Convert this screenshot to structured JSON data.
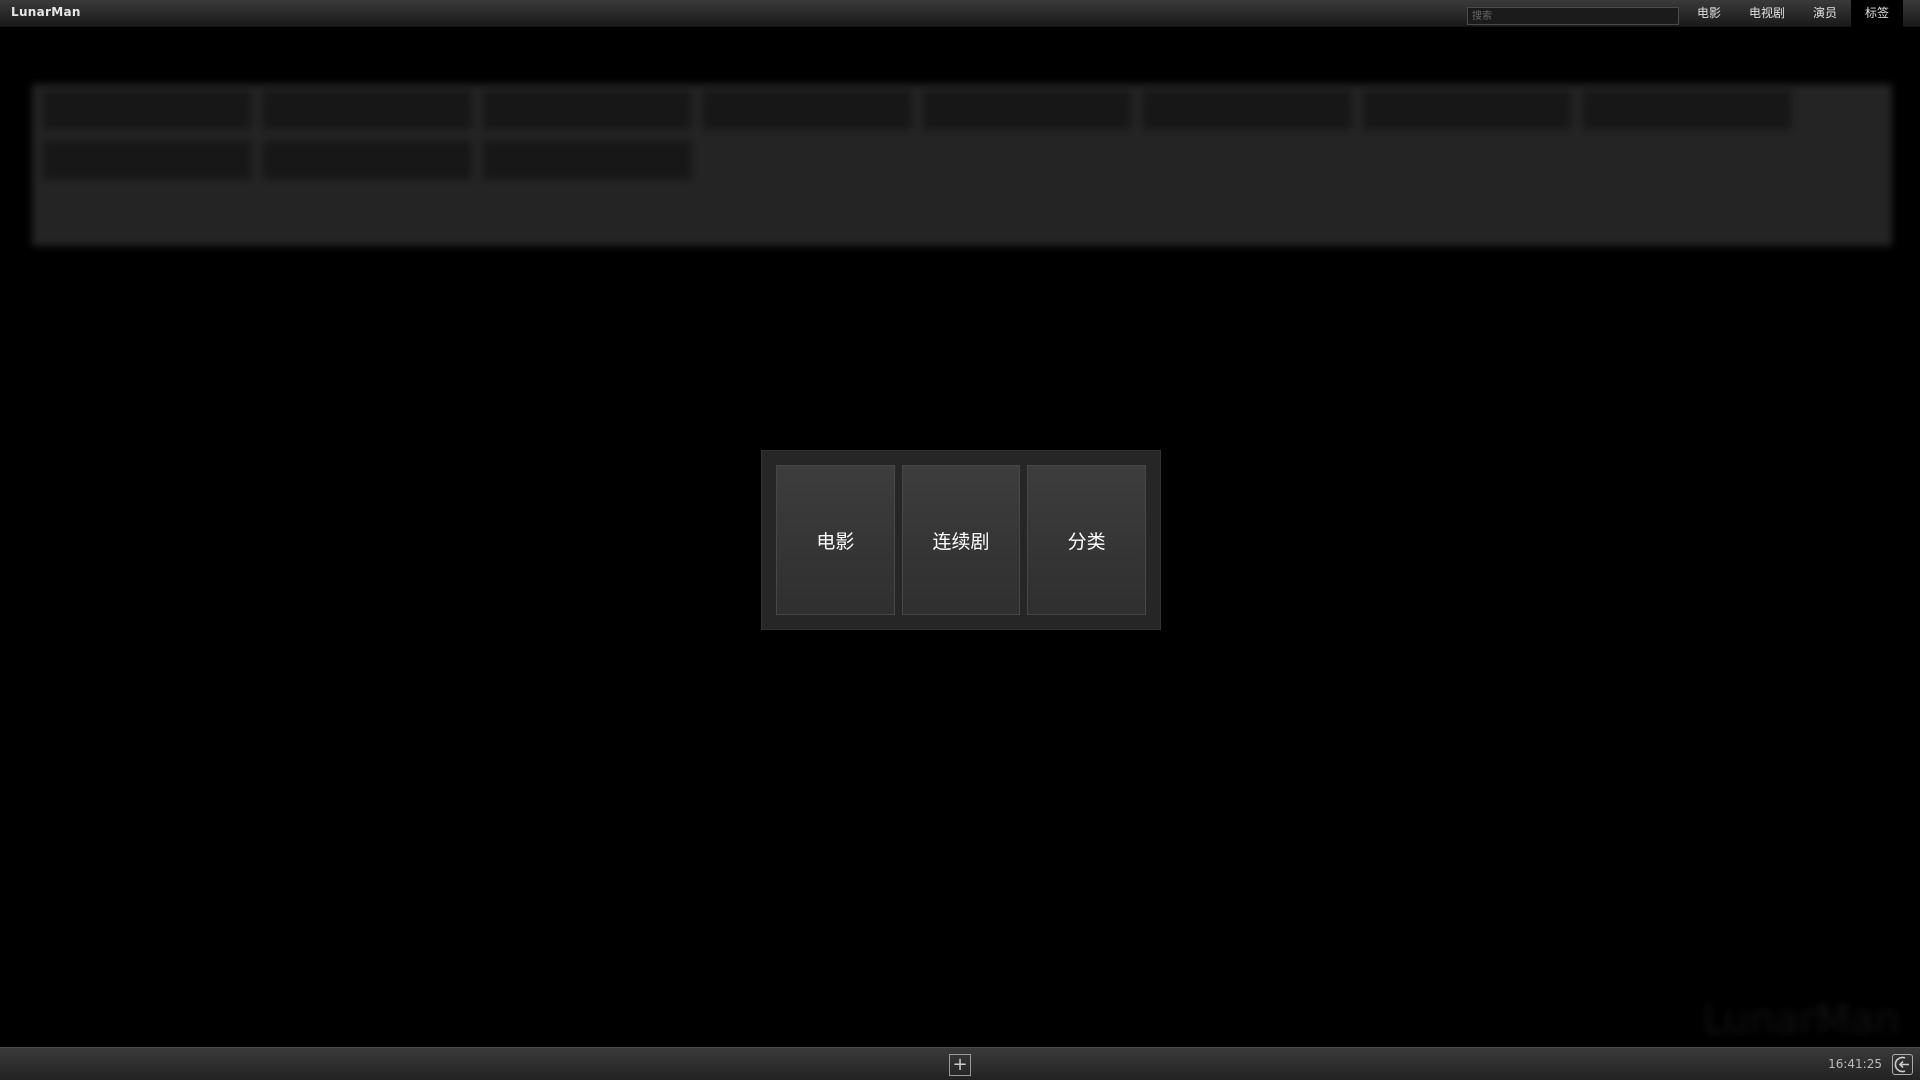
{
  "app": {
    "title": "LunarMan",
    "watermark": "LunarMan"
  },
  "header": {
    "search_placeholder": "搜索",
    "nav": [
      {
        "label": "电影",
        "active": false
      },
      {
        "label": "电视剧",
        "active": false
      },
      {
        "label": "演员",
        "active": false
      },
      {
        "label": "标签",
        "active": true
      }
    ]
  },
  "background": {
    "section_title": "",
    "tags": [
      "",
      "",
      "",
      "",
      "",
      "",
      "",
      "",
      "",
      "",
      ""
    ]
  },
  "popup": {
    "buttons": [
      {
        "label": "电影"
      },
      {
        "label": "连续剧"
      },
      {
        "label": "分类"
      }
    ]
  },
  "footer": {
    "add_label": "+",
    "clock": "16:41:25"
  },
  "colors": {
    "background": "#000000",
    "bar": "#2c2c2c",
    "popup": "#262626",
    "popup_button": "#363636"
  }
}
